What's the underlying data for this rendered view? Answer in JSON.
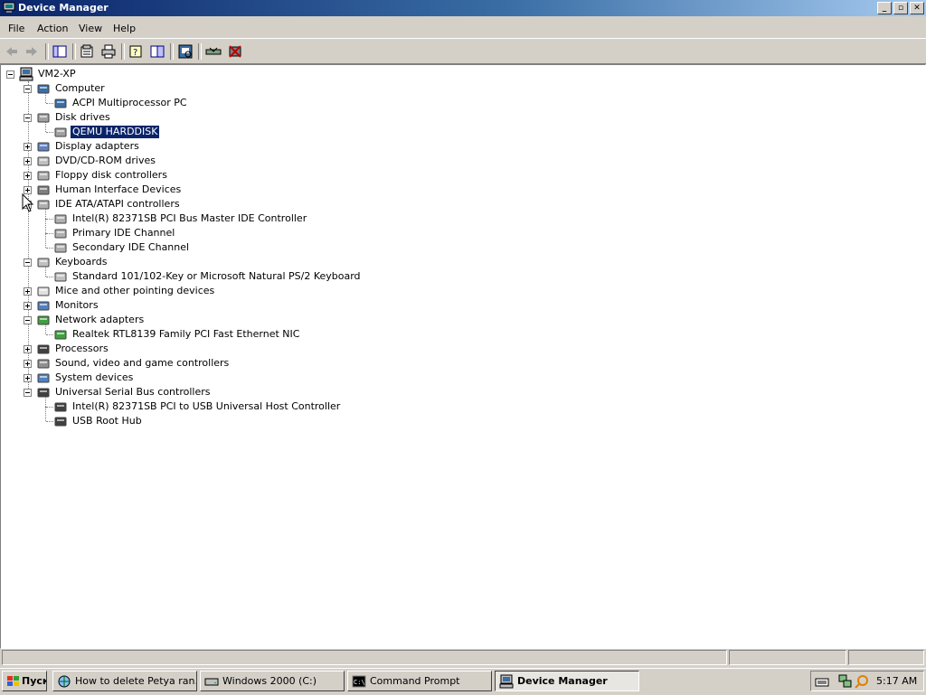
{
  "window": {
    "title": "Device Manager",
    "title_icon": "computer-monitor-icon",
    "buttons": [
      "minimize",
      "maximize",
      "close"
    ]
  },
  "menubar": {
    "file": "File",
    "action": "Action",
    "view": "View",
    "help": "Help"
  },
  "toolbar": {
    "icons": [
      "back-arrow-icon",
      "forward-arrow-icon",
      "console-tree-icon",
      "properties-icon",
      "print-icon",
      "help-icon",
      "show-hide-icon",
      "scan-hardware-icon",
      "update-driver-icon",
      "uninstall-icon"
    ]
  },
  "tree": {
    "root": "VM2-XP",
    "items": [
      {
        "label": "Computer",
        "icon": "computer-icon",
        "expanded": true
      },
      {
        "label": "ACPI Multiprocessor PC",
        "icon": "computer-icon"
      },
      {
        "label": "Disk drives",
        "icon": "disk-drive-icon",
        "expanded": true
      },
      {
        "label": "QEMU HARDDISK",
        "icon": "disk-drive-icon",
        "selected": true
      },
      {
        "label": "Display adapters",
        "icon": "display-adapter-icon",
        "expanded": false
      },
      {
        "label": "DVD/CD-ROM drives",
        "icon": "cdrom-icon",
        "expanded": false
      },
      {
        "label": "Floppy disk controllers",
        "icon": "floppy-controller-icon",
        "expanded": false
      },
      {
        "label": "Human Interface Devices",
        "icon": "hid-icon",
        "expanded": false
      },
      {
        "label": "IDE ATA/ATAPI controllers",
        "icon": "ide-controller-icon",
        "expanded": true
      },
      {
        "label": "Intel(R) 82371SB PCI Bus Master IDE Controller",
        "icon": "ide-controller-icon"
      },
      {
        "label": "Primary IDE Channel",
        "icon": "ide-controller-icon"
      },
      {
        "label": "Secondary IDE Channel",
        "icon": "ide-controller-icon"
      },
      {
        "label": "Keyboards",
        "icon": "keyboard-icon",
        "expanded": true
      },
      {
        "label": "Standard 101/102-Key or Microsoft Natural PS/2 Keyboard",
        "icon": "keyboard-icon"
      },
      {
        "label": "Mice and other pointing devices",
        "icon": "mouse-icon",
        "expanded": false
      },
      {
        "label": "Monitors",
        "icon": "monitor-icon",
        "expanded": false
      },
      {
        "label": "Network adapters",
        "icon": "network-adapter-icon",
        "expanded": true
      },
      {
        "label": "Realtek RTL8139 Family PCI Fast Ethernet NIC",
        "icon": "network-adapter-icon"
      },
      {
        "label": "Processors",
        "icon": "processor-icon",
        "expanded": false
      },
      {
        "label": "Sound, video and game controllers",
        "icon": "sound-icon",
        "expanded": false
      },
      {
        "label": "System devices",
        "icon": "system-device-icon",
        "expanded": false
      },
      {
        "label": "Universal Serial Bus controllers",
        "icon": "usb-icon",
        "expanded": true
      },
      {
        "label": "Intel(R) 82371SB PCI to USB Universal Host Controller",
        "icon": "usb-icon"
      },
      {
        "label": "USB Root Hub",
        "icon": "usb-icon"
      }
    ]
  },
  "taskbar": {
    "start_label": "Пуск",
    "buttons": [
      {
        "label": "How to delete Petya ran...",
        "icon": "browser-icon",
        "active": false
      },
      {
        "label": "Windows 2000 (C:)",
        "icon": "drive-icon",
        "active": false
      },
      {
        "label": "Command Prompt",
        "icon": "cmd-icon",
        "active": false
      },
      {
        "label": "Device Manager",
        "icon": "device-manager-icon",
        "active": true
      }
    ],
    "tray_icons": [
      "keyboard-layout-icon",
      "network-tray-icon",
      "search-tray-icon"
    ],
    "clock": "5:17 AM"
  },
  "colors": {
    "titlebar_start": "#0a246a",
    "titlebar_end": "#a6caf0",
    "selection": "#0a246a",
    "face": "#d4d0c8"
  }
}
